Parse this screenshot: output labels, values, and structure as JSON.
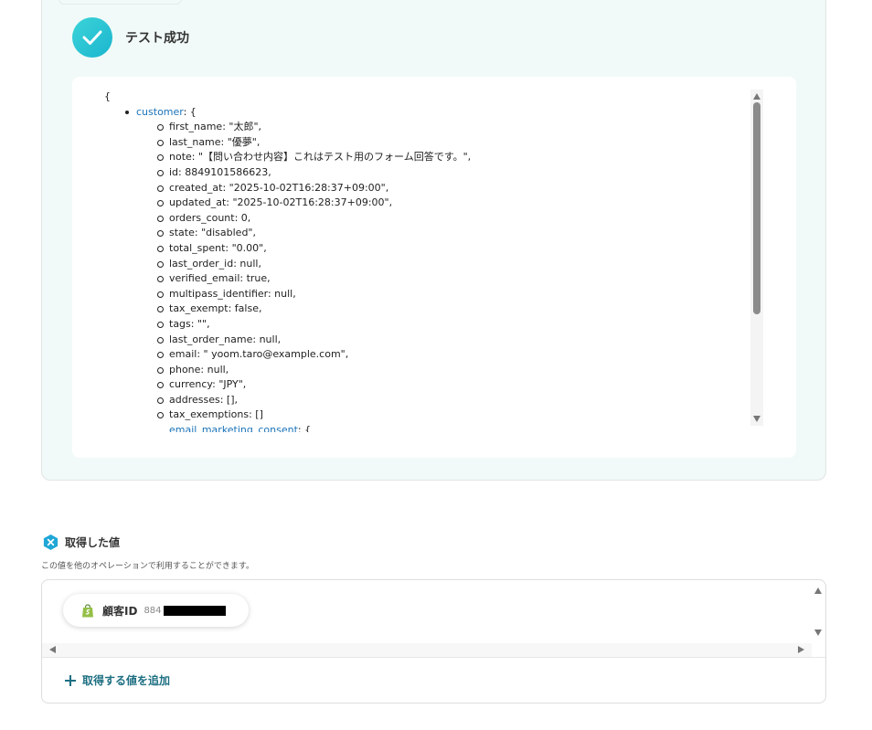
{
  "result": {
    "status_label": "テスト成功",
    "json_open": "{",
    "top_key": "customer",
    "top_key_suffix": ": {",
    "fields": [
      "first_name: \"太郎\",",
      "last_name: \"優夢\",",
      "note: \"【問い合わせ内容】これはテスト用のフォーム回答です。\",",
      "id: 8849101586623,",
      "created_at: \"2025-10-02T16:28:37+09:00\",",
      "updated_at: \"2025-10-02T16:28:37+09:00\",",
      "orders_count: 0,",
      "state: \"disabled\",",
      "total_spent: \"0.00\",",
      "last_order_id: null,",
      "verified_email: true,",
      "multipass_identifier: null,",
      "tax_exempt: false,",
      "tags: \"\",",
      "last_order_name: null,",
      "email: \" yoom.taro@example.com\",",
      "phone: null,",
      "currency: \"JPY\",",
      "addresses: [],",
      "tax_exemptions: []"
    ],
    "clipped_key": "email_marketing_consent",
    "clipped_suffix": ": {"
  },
  "acquired": {
    "title": "取得した値",
    "description": "この値を他のオペレーションで利用することができます。",
    "chip_label": "顧客ID",
    "chip_value_prefix": "884",
    "add_label": "取得する値を追加"
  },
  "colors": {
    "accent": "#1d6f82",
    "success_gradient_start": "#3cd4d8",
    "success_gradient_end": "#1bb5cf",
    "panel_bg": "#f1faf8",
    "shopify_green": "#95bf47"
  }
}
